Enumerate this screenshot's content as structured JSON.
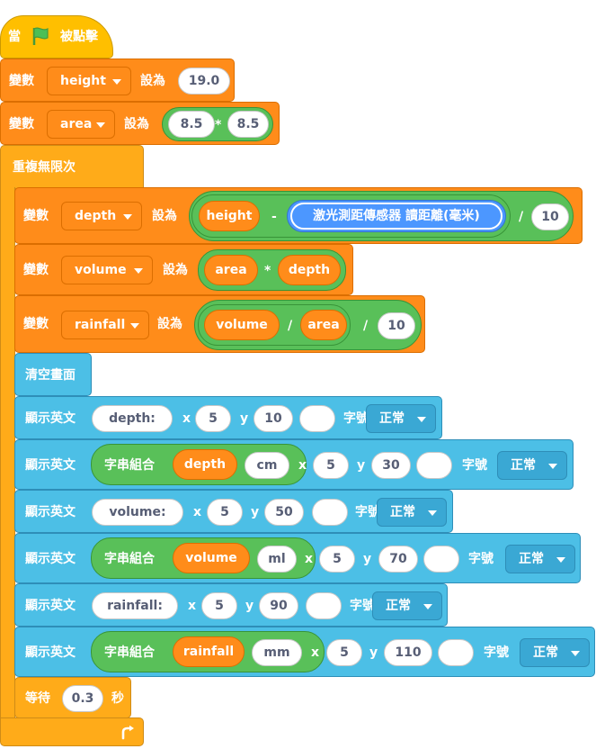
{
  "hat": {
    "when": "當",
    "flag_icon": "green-flag-icon",
    "clicked": "被點擊"
  },
  "set_label": "變數",
  "to_label": "設為",
  "x_label": "x",
  "y_label": "y",
  "size_label": "字號",
  "set1": {
    "var": "height",
    "value": "19.0"
  },
  "set2": {
    "var": "area",
    "a": "8.5",
    "op": "*",
    "b": "8.5"
  },
  "forever": "重複無限次",
  "set3": {
    "var": "depth",
    "left": "height",
    "minus": "-",
    "sensor": "激光測距傳感器 讀距離(毫米)",
    "div": "/",
    "divisor": "10"
  },
  "set4": {
    "var": "volume",
    "left": "area",
    "op": "*",
    "right": "depth"
  },
  "set5": {
    "var": "rainfall",
    "left": "volume",
    "op1": "/",
    "mid": "area",
    "op2": "/",
    "divisor": "10"
  },
  "clear": "清空畫面",
  "show_label": "顯示英文",
  "join_label": "字串組合",
  "style_value": "正常",
  "show1": {
    "text": "depth:",
    "x": "5",
    "y": "10"
  },
  "show2": {
    "join_a": "depth",
    "join_b": "cm",
    "x": "5",
    "y": "30"
  },
  "show3": {
    "text": "volume:",
    "x": "5",
    "y": "50"
  },
  "show4": {
    "join_a": "volume",
    "join_b": "ml",
    "x": "5",
    "y": "70"
  },
  "show5": {
    "text": "rainfall:",
    "x": "5",
    "y": "90"
  },
  "show6": {
    "join_a": "rainfall",
    "join_b": "mm",
    "x": "5",
    "y": "110"
  },
  "wait": {
    "label": "等待",
    "value": "0.3",
    "unit": "秒"
  },
  "loop_arrow_icon": "loop-arrow-icon",
  "colors": {
    "event": "#ffbf00",
    "variables": "#ff8c1a",
    "control": "#ffab19",
    "looks": "#4cbfe6",
    "operators": "#59c059",
    "sensing": "#4c97ff"
  }
}
